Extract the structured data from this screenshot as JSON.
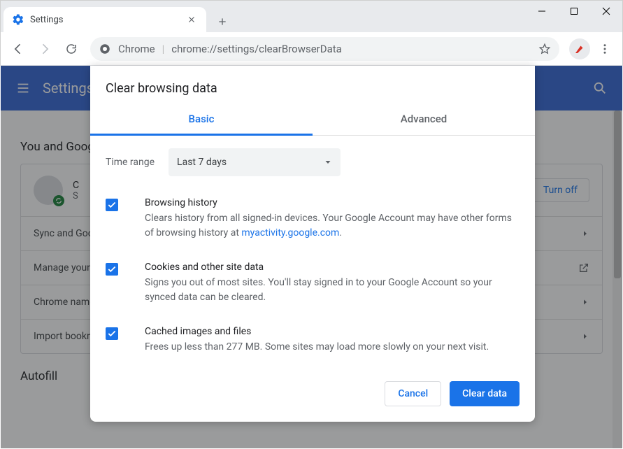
{
  "tab": {
    "title": "Settings"
  },
  "omnibox": {
    "origin_label": "Chrome",
    "url_path": "chrome://settings/clearBrowserData"
  },
  "settings_header": {
    "title": "Settings"
  },
  "section": {
    "you_and_google": "You and Google",
    "autofill": "Autofill"
  },
  "profile_row": {
    "name_initial": "C",
    "sub_initial": "S"
  },
  "turn_off": "Turn off",
  "rows": {
    "sync": "Sync and Google services",
    "manage": "Manage your Google Account",
    "chrome_name": "Chrome name and picture",
    "import": "Import bookmarks and settings"
  },
  "dialog": {
    "title": "Clear browsing data",
    "tab_basic": "Basic",
    "tab_advanced": "Advanced",
    "time_range_label": "Time range",
    "time_range_value": "Last 7 days",
    "opts": [
      {
        "title": "Browsing history",
        "desc_pre": "Clears history from all signed-in devices. Your Google Account may have other forms of browsing history at ",
        "link": "myactivity.google.com",
        "desc_post": "."
      },
      {
        "title": "Cookies and other site data",
        "desc": "Signs you out of most sites. You'll stay signed in to your Google Account so your synced data can be cleared."
      },
      {
        "title": "Cached images and files",
        "desc": "Frees up less than 277 MB. Some sites may load more slowly on your next visit."
      }
    ],
    "cancel": "Cancel",
    "clear": "Clear data"
  }
}
